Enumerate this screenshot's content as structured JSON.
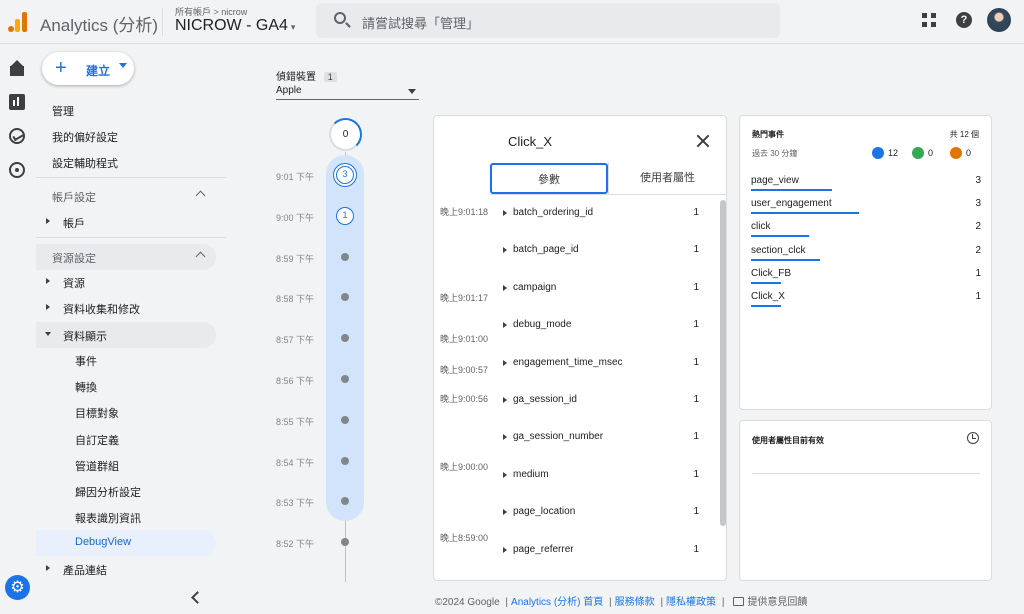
{
  "header": {
    "app_title": "Analytics (分析)",
    "account_crumb": "所有帳戶 > nicrow",
    "property_name": "NICROW - GA4",
    "property_caret": "▾",
    "search_placeholder": "請嘗試搜尋「管理」",
    "help_label": "?"
  },
  "rail": {
    "settings_glyph": "⚙"
  },
  "admin_nav": {
    "create_label": "建立",
    "create_plus": "+",
    "top_links": [
      "管理",
      "我的偏好設定",
      "設定輔助程式"
    ],
    "account_section": {
      "title": "帳戶設定",
      "items": [
        "帳戶"
      ]
    },
    "property_section": {
      "title": "資源設定",
      "items": [
        "資源",
        "資料收集和修改"
      ],
      "expanded_item": "資料顯示",
      "sub_items": [
        "事件",
        "轉換",
        "目標對象",
        "自訂定義",
        "管道群組",
        "歸因分析設定",
        "報表識別資訊",
        "DebugView"
      ],
      "active_sub_item": "DebugView",
      "trailing_item": "產品連結"
    }
  },
  "device": {
    "label": "偵錯裝置",
    "count": "1",
    "value": "Apple"
  },
  "minutes_timeline": {
    "top_count": "0",
    "minutes": [
      {
        "label": "9:01 下午",
        "count": "3"
      },
      {
        "label": "9:00 下午",
        "count": "1"
      },
      {
        "label": "8:59 下午",
        "count": ""
      },
      {
        "label": "8:58 下午",
        "count": ""
      },
      {
        "label": "8:57 下午",
        "count": ""
      },
      {
        "label": "8:56 下午",
        "count": ""
      },
      {
        "label": "8:55 下午",
        "count": ""
      },
      {
        "label": "8:54 下午",
        "count": ""
      },
      {
        "label": "8:53 下午",
        "count": ""
      },
      {
        "label": "8:52 下午",
        "count": ""
      }
    ]
  },
  "event_card": {
    "event_name": "Click_X",
    "tabs": [
      "參數",
      "使用者屬性"
    ],
    "active_tab": "參數",
    "seconds": [
      "晚上9:01:18",
      "晚上9:01:17",
      "晚上9:01:00",
      "晚上9:00:57",
      "晚上9:00:56",
      "晚上9:00:00",
      "晚上8:59:00"
    ],
    "parameters": [
      {
        "name": "batch_ordering_id",
        "value": "1"
      },
      {
        "name": "batch_page_id",
        "value": "1"
      },
      {
        "name": "campaign",
        "value": "1"
      },
      {
        "name": "debug_mode",
        "value": "1"
      },
      {
        "name": "engagement_time_msec",
        "value": "1"
      },
      {
        "name": "ga_session_id",
        "value": "1"
      },
      {
        "name": "ga_session_number",
        "value": "1"
      },
      {
        "name": "medium",
        "value": "1"
      },
      {
        "name": "page_location",
        "value": "1"
      },
      {
        "name": "page_referrer",
        "value": "1"
      }
    ]
  },
  "top_events": {
    "title": "熱門事件",
    "total": "共 12 個",
    "subtitle": "過去 30 分鐘",
    "badges": [
      {
        "icon": "user-icon",
        "count": "12",
        "color": "#1a73e8"
      },
      {
        "icon": "flag-icon",
        "count": "0",
        "color": "#34a853"
      },
      {
        "icon": "error-icon",
        "count": "0",
        "color": "#e37400"
      }
    ],
    "events": [
      {
        "name": "page_view",
        "count": "3",
        "bar_fraction": 0.35
      },
      {
        "name": "user_engagement",
        "count": "3",
        "bar_fraction": 0.47
      },
      {
        "name": "click",
        "count": "2",
        "bar_fraction": 0.25
      },
      {
        "name": "section_clck",
        "count": "2",
        "bar_fraction": 0.3
      },
      {
        "name": "Click_FB",
        "count": "1",
        "bar_fraction": 0.13
      },
      {
        "name": "Click_X",
        "count": "1",
        "bar_fraction": 0.13
      }
    ]
  },
  "user_props": {
    "title": "使用者屬性目前有效"
  },
  "footer": {
    "copyright": "©2024 Google",
    "home_link": "Analytics (分析) 首頁",
    "terms_link": "服務條款",
    "privacy_link": "隱私權政策",
    "feedback": "提供意見回饋",
    "separator": "|"
  }
}
